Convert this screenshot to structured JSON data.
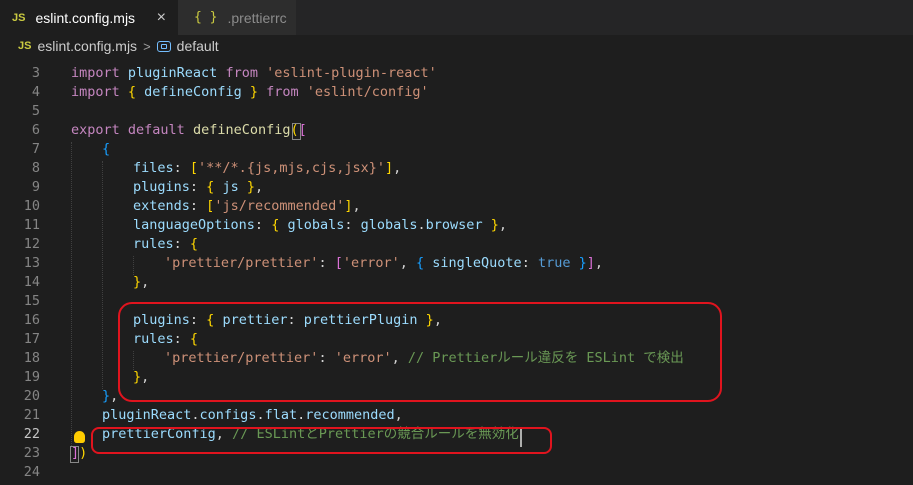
{
  "tabs": [
    {
      "icon": "JS",
      "label": "eslint.config.mjs",
      "close": "×"
    },
    {
      "icon": "{ }",
      "label": ".prettierrc"
    }
  ],
  "breadcrumb": {
    "icon": "JS",
    "file": "eslint.config.mjs",
    "separator": ">",
    "symbol": "default"
  },
  "line_numbers": [
    "3",
    "4",
    "5",
    "6",
    "7",
    "8",
    "9",
    "10",
    "11",
    "12",
    "13",
    "14",
    "15",
    "16",
    "17",
    "18",
    "19",
    "20",
    "21",
    "22",
    "23",
    "24"
  ],
  "active_line": "22",
  "code": {
    "l3": {
      "a": "import ",
      "b": "pluginReact",
      "c": " from ",
      "d": "'eslint-plugin-react'"
    },
    "l4": {
      "a": "import ",
      "b": "{",
      "c": " defineConfig ",
      "d": "}",
      "e": " from ",
      "f": "'eslint/config'"
    },
    "l6": {
      "a": "export ",
      "b": "default ",
      "c": "defineConfig",
      "d": "(",
      "e": "["
    },
    "l7": {
      "a": "{"
    },
    "l8": {
      "a": "files",
      ": ": ": ",
      "b": "[",
      "c": "'**/*.{js,mjs,cjs,jsx}'",
      "d": "]",
      "e": ","
    },
    "l9": {
      "a": "plugins",
      ": ": ": ",
      "b": "{",
      "c": " js ",
      "d": "}",
      "e": ","
    },
    "l10": {
      "a": "extends",
      ": ": ": ",
      "b": "[",
      "c": "'js/recommended'",
      "d": "]",
      "e": ","
    },
    "l11": {
      "a": "languageOptions",
      ": ": ": ",
      "b": "{",
      "c": " globals",
      ": 2": ": ",
      "d": "globals",
      "e": ".",
      "f": "browser",
      "g": " ",
      "h": "}",
      "i": ","
    },
    "l12": {
      "a": "rules",
      ": ": ": ",
      "b": "{"
    },
    "l13": {
      "a": "'prettier/prettier'",
      ": ": ": ",
      "b": "[",
      "c": "'error'",
      "d": ", ",
      "e": "{",
      "f": " singleQuote",
      ": 2": ": ",
      "g": "true",
      "h": " ",
      "i": "}",
      "j": "]",
      "k": ","
    },
    "l14": {
      "a": "}",
      "b": ","
    },
    "l16": {
      "a": "plugins",
      ": ": ": ",
      "b": "{",
      "c": " prettier",
      ": 2": ": ",
      "d": "prettierPlugin",
      "e": " ",
      "f": "}",
      "g": ","
    },
    "l17": {
      "a": "rules",
      ": ": ": ",
      "b": "{"
    },
    "l18": {
      "a": "'prettier/prettier'",
      ": ": ": ",
      "b": "'error'",
      "c": ", ",
      "d": "// Prettierルール違反を ESLint で検出"
    },
    "l19": {
      "a": "}",
      "b": ","
    },
    "l20": {
      "a": "}",
      "b": ","
    },
    "l21": {
      "a": "pluginReact",
      "b": ".",
      "c": "configs",
      "d": ".",
      "e": "flat",
      "f": ".",
      "g": "recommended",
      "h": ","
    },
    "l22": {
      "a": "prettierConfig",
      "b": ", ",
      "c": "// ESLintとPrettierの競合ルールを無効化"
    },
    "l23": {
      "a": "]",
      "b": ")"
    }
  },
  "colors": {
    "highlight_border": "#e0141e",
    "editor_bg": "#1e1e1e",
    "keyword": "#c586c0",
    "string": "#ce9178",
    "comment": "#6a9955"
  }
}
